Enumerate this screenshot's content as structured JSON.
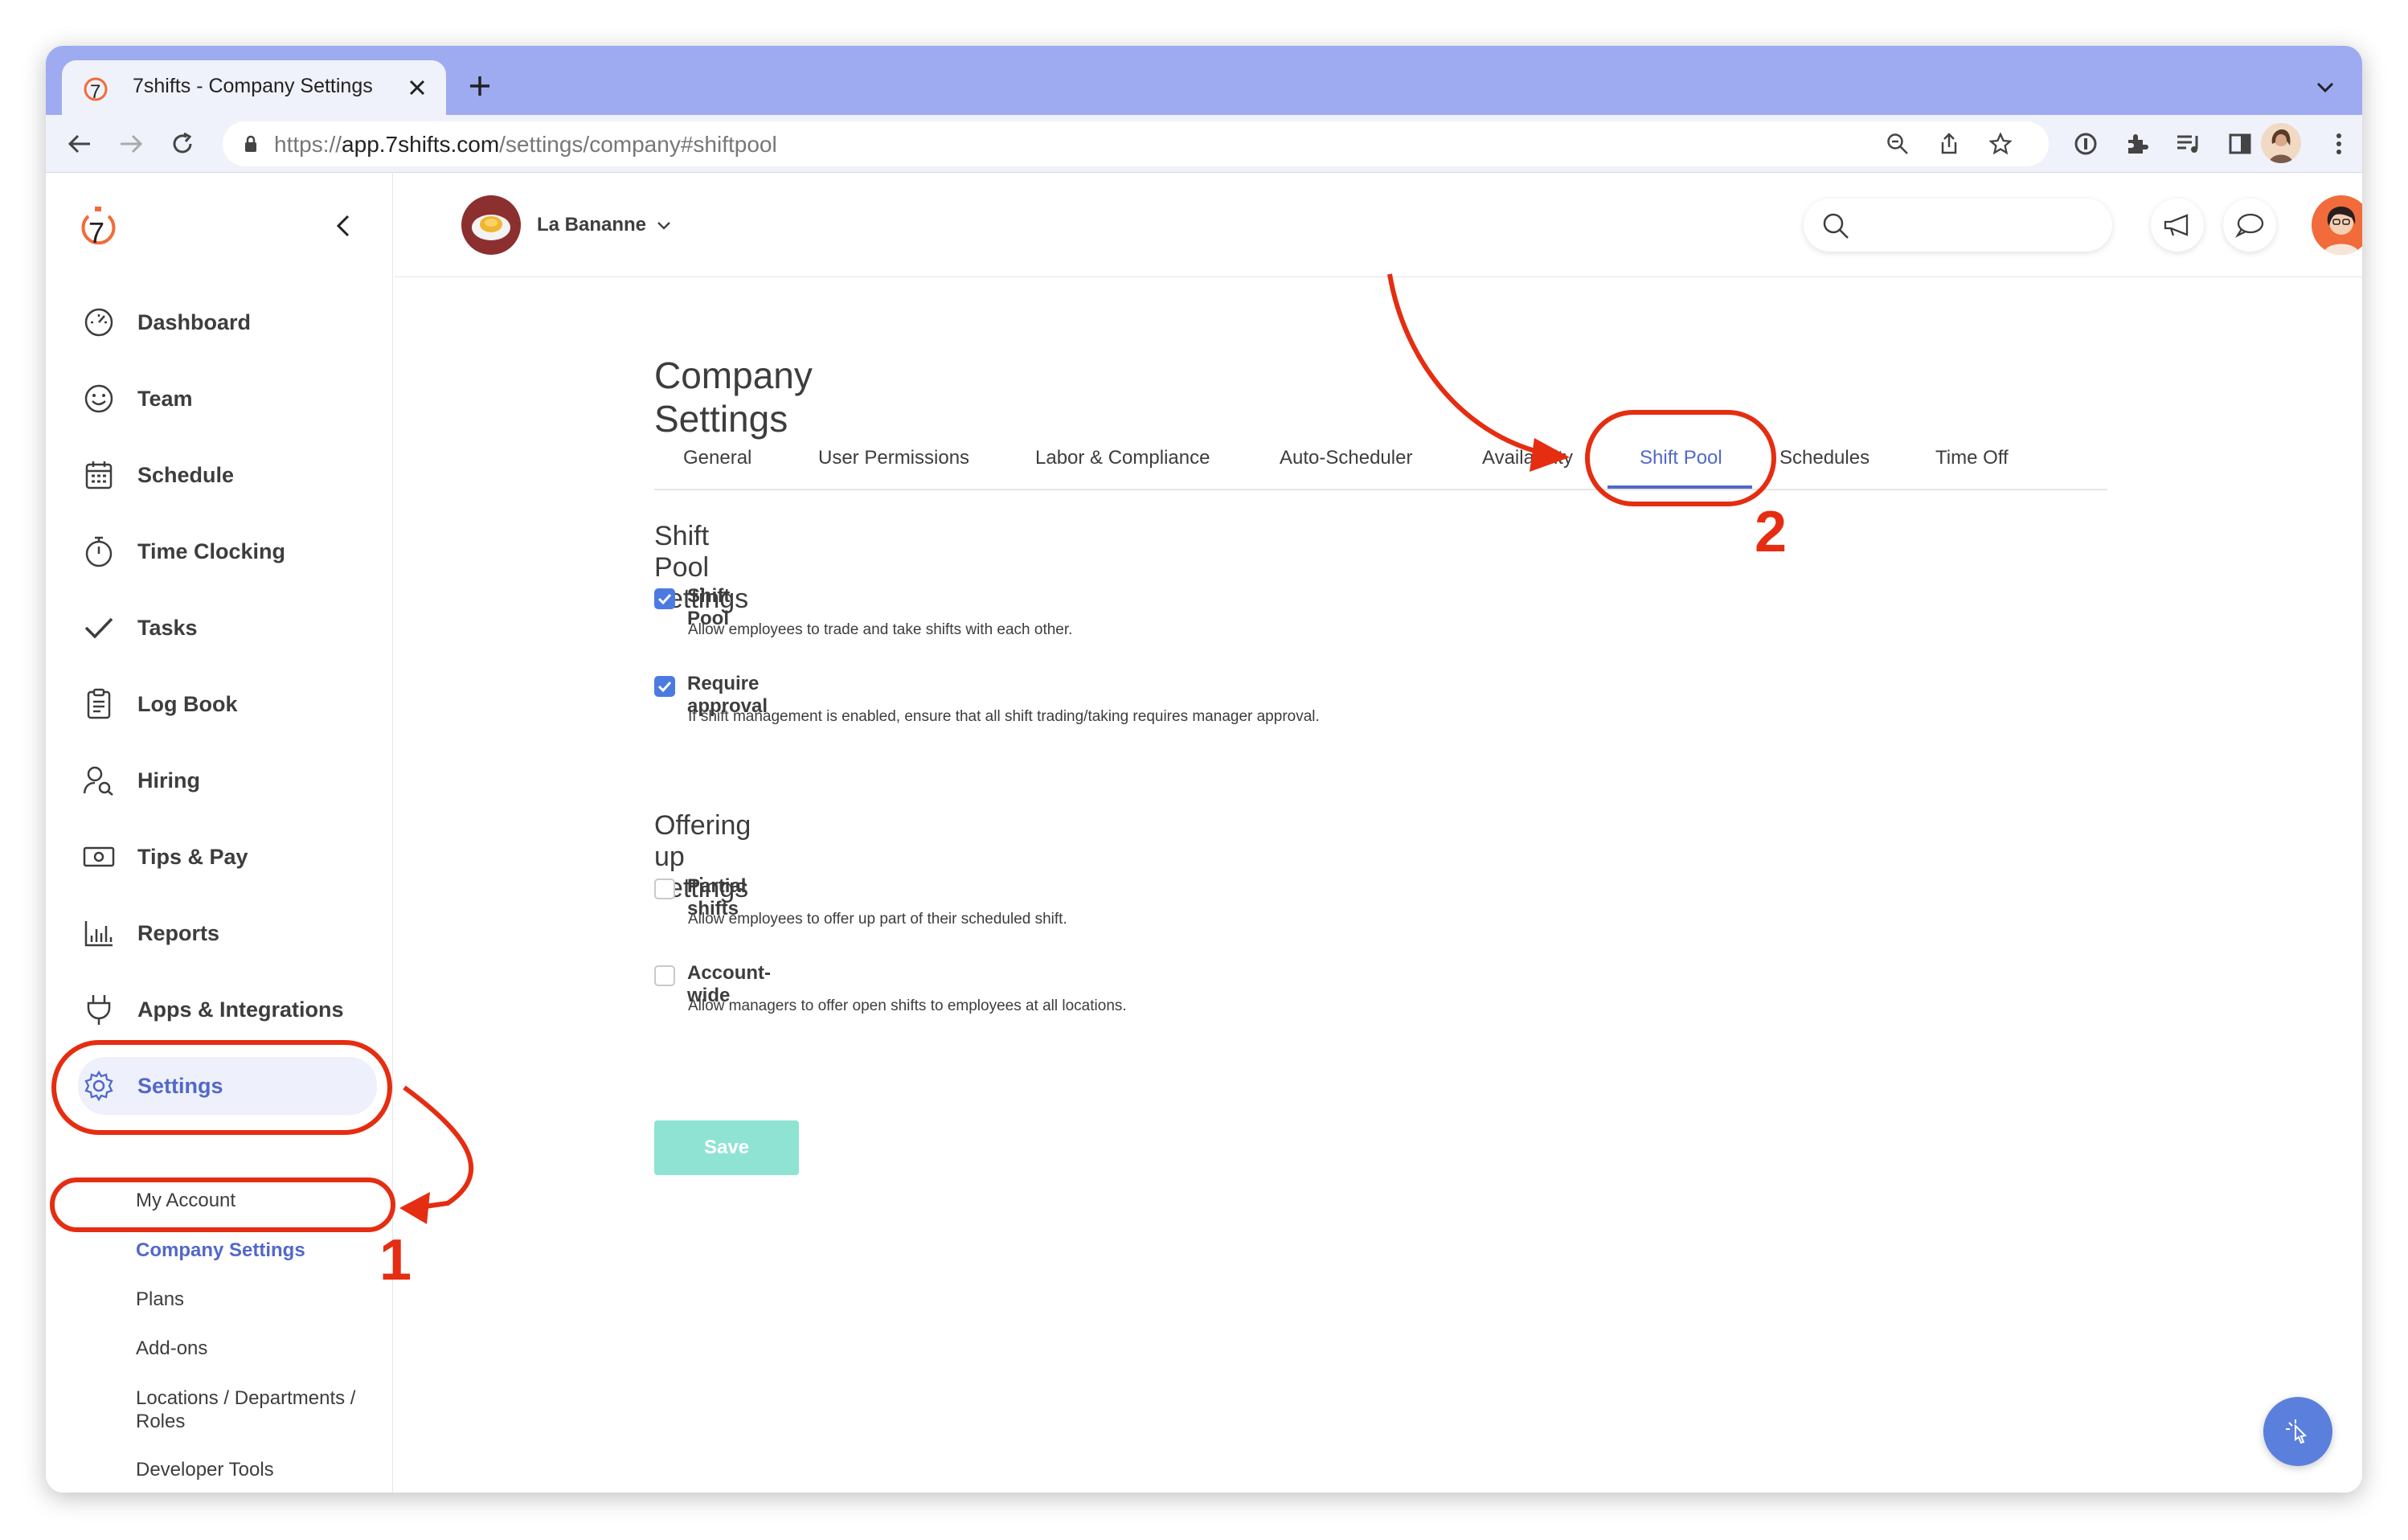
{
  "browser": {
    "tab_title": "7shifts - Company Settings",
    "url_prefix": "https://",
    "url_domain": "app.7shifts.com",
    "url_path": "/settings/company#shiftpool"
  },
  "app": {
    "logo_text": "7",
    "location_name": "La Bananne"
  },
  "sidebar": {
    "items": [
      {
        "label": "Dashboard",
        "icon": "dashboard-icon"
      },
      {
        "label": "Team",
        "icon": "smiley-icon"
      },
      {
        "label": "Schedule",
        "icon": "calendar-icon"
      },
      {
        "label": "Time Clocking",
        "icon": "stopwatch-icon"
      },
      {
        "label": "Tasks",
        "icon": "check-icon"
      },
      {
        "label": "Log Book",
        "icon": "clipboard-icon"
      },
      {
        "label": "Hiring",
        "icon": "person-search-icon"
      },
      {
        "label": "Tips & Pay",
        "icon": "money-icon"
      },
      {
        "label": "Reports",
        "icon": "bar-chart-icon"
      },
      {
        "label": "Apps & Integrations",
        "icon": "plug-icon"
      },
      {
        "label": "Settings",
        "icon": "gear-icon"
      }
    ],
    "sub_items": [
      {
        "label": "My Account"
      },
      {
        "label": "Company Settings"
      },
      {
        "label": "Plans"
      },
      {
        "label": "Add-ons"
      },
      {
        "label": "Locations / Departments / Roles"
      },
      {
        "label": "Developer Tools"
      }
    ]
  },
  "page": {
    "title": "Company Settings",
    "tabs": [
      {
        "label": "General"
      },
      {
        "label": "User Permissions"
      },
      {
        "label": "Labor & Compliance"
      },
      {
        "label": "Auto-Scheduler"
      },
      {
        "label": "Availability"
      },
      {
        "label": "Shift Pool"
      },
      {
        "label": "Schedules"
      },
      {
        "label": "Time Off"
      }
    ],
    "active_tab": "Shift Pool",
    "shift_pool_section": {
      "heading": "Shift Pool settings",
      "options": [
        {
          "label": "Shift Pool",
          "description": "Allow employees to trade and take shifts with each other.",
          "checked": true
        },
        {
          "label": "Require approval",
          "description": "If shift management is enabled, ensure that all shift trading/taking requires manager approval.",
          "checked": true
        }
      ]
    },
    "offering_section": {
      "heading": "Offering up settings",
      "options": [
        {
          "label": "Partial shifts",
          "description": "Allow employees to offer up part of their scheduled shift.",
          "checked": false
        },
        {
          "label": "Account-wide",
          "description": "Allow managers to offer open shifts to employees at all locations.",
          "checked": false
        }
      ]
    },
    "save_label": "Save"
  },
  "annotations": {
    "step1": "1",
    "step2": "2"
  },
  "colors": {
    "accent": "#5268c9",
    "checkbox": "#4b7be0",
    "save_button": "#8fe3d2",
    "annotation": "#e52d12",
    "brand": "#f26b3a"
  }
}
